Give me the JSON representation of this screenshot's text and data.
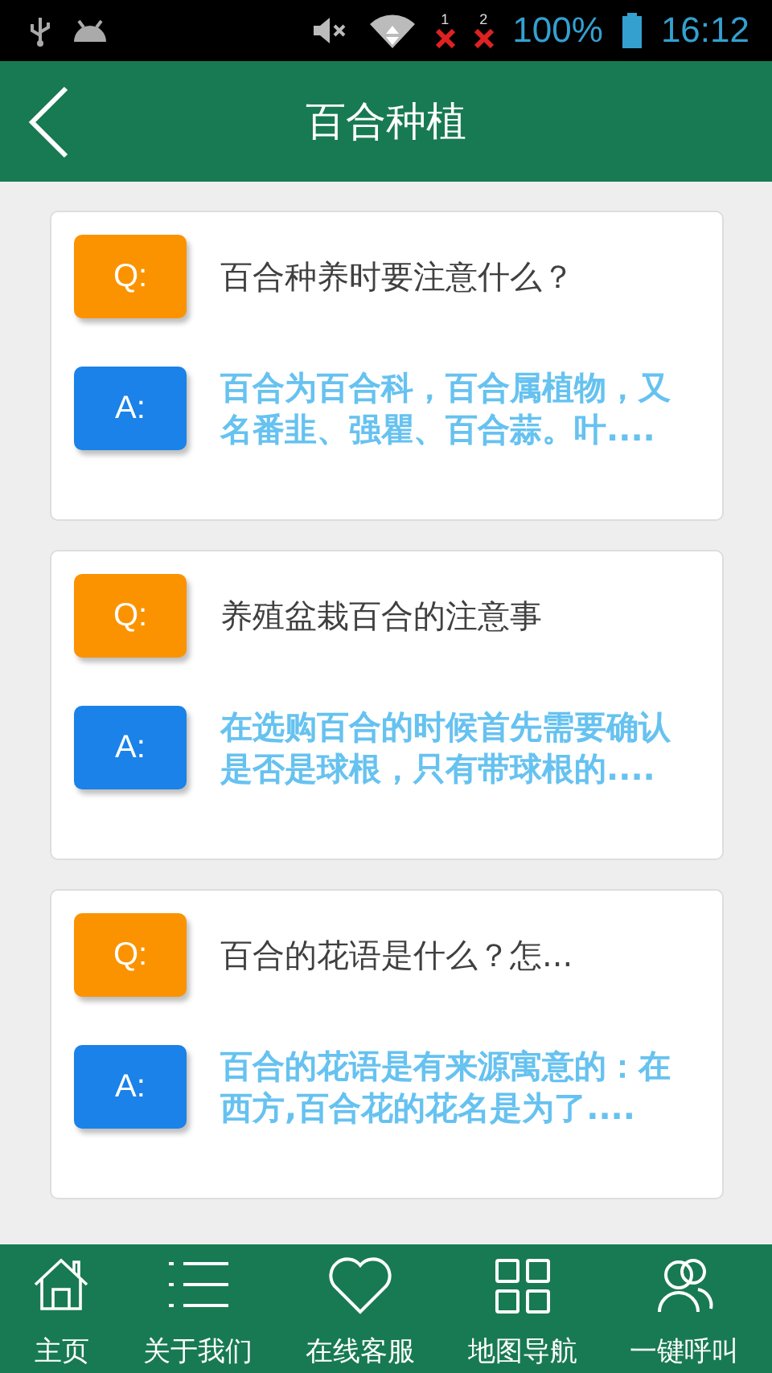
{
  "status_bar": {
    "sim_1": "1",
    "sim_2": "2",
    "battery": "100%",
    "time": "16:12"
  },
  "header": {
    "title": "百合种植"
  },
  "qa_items": [
    {
      "q_badge": "Q:",
      "question": "百合种养时要注意什么？",
      "a_badge": "A:",
      "answer": "百合为百合科，百合属植物，又名番韭、强瞿、百合蒜。叶...."
    },
    {
      "q_badge": "Q:",
      "question": "养殖盆栽百合的注意事",
      "a_badge": "A:",
      "answer": "在选购百合的时候首先需要确认是否是球根，只有带球根的...."
    },
    {
      "q_badge": "Q:",
      "question": "百合的花语是什么？怎...",
      "a_badge": "A:",
      "answer": "百合的花语是有来源寓意的：在西方,百合花的花名是为了...."
    }
  ],
  "bottom_nav": [
    {
      "kind": "home",
      "label": "主页"
    },
    {
      "kind": "list",
      "label": "关于我们"
    },
    {
      "kind": "heart",
      "label": "在线客服"
    },
    {
      "kind": "grid",
      "label": "地图导航"
    },
    {
      "kind": "people",
      "label": "一键呼叫"
    }
  ]
}
